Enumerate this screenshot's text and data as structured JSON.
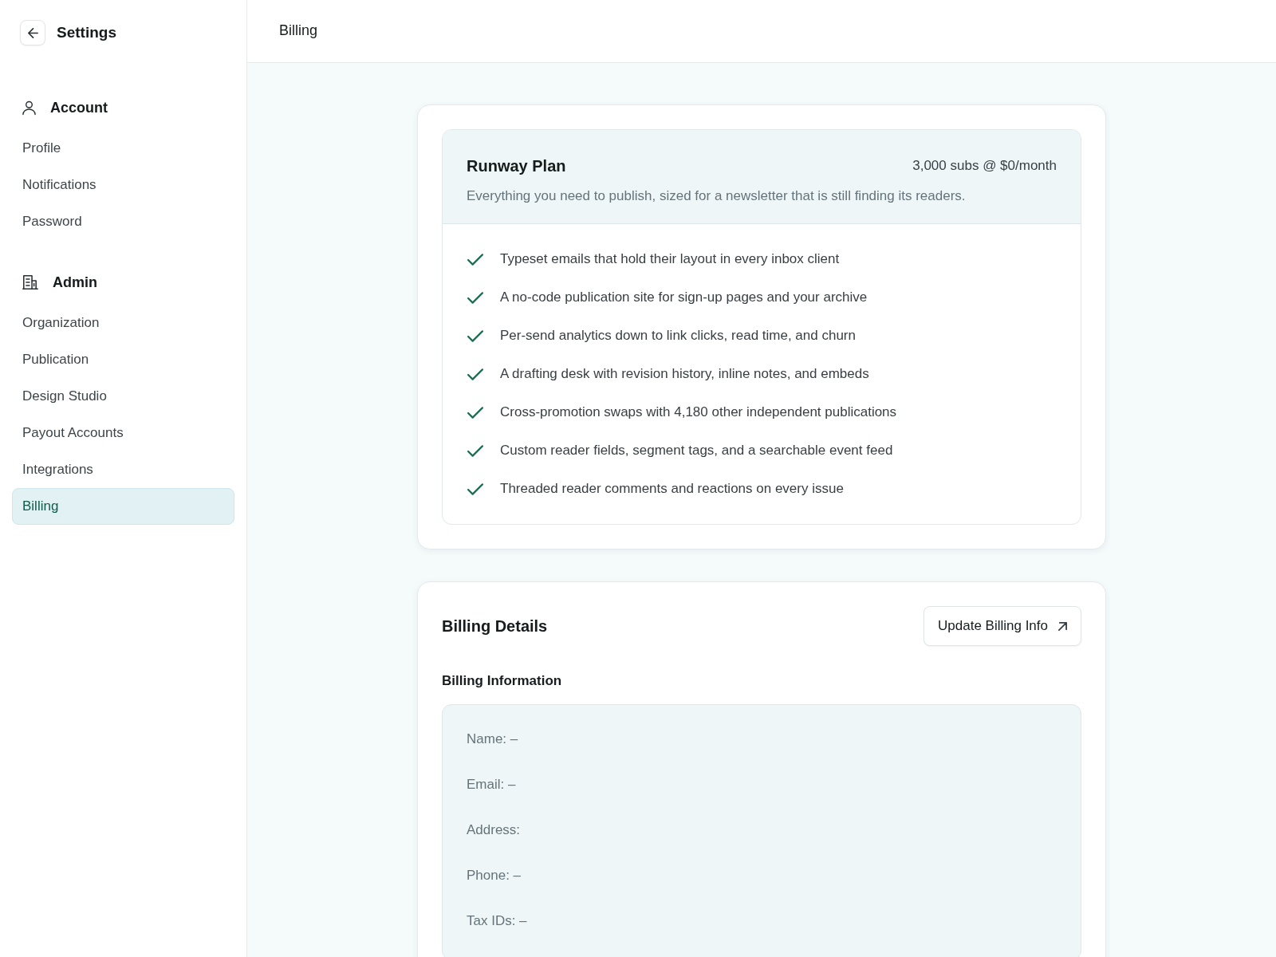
{
  "sidebar": {
    "title": "Settings",
    "sections": [
      {
        "heading": "Account",
        "items": [
          {
            "label": "Profile",
            "selected": false
          },
          {
            "label": "Notifications",
            "selected": false
          },
          {
            "label": "Password",
            "selected": false
          }
        ]
      },
      {
        "heading": "Admin",
        "items": [
          {
            "label": "Organization",
            "selected": false
          },
          {
            "label": "Publication",
            "selected": false
          },
          {
            "label": "Design Studio",
            "selected": false
          },
          {
            "label": "Payout Accounts",
            "selected": false
          },
          {
            "label": "Integrations",
            "selected": false
          },
          {
            "label": "Billing",
            "selected": true
          }
        ]
      }
    ]
  },
  "header": {
    "title": "Billing"
  },
  "plan": {
    "name": "Runway Plan",
    "price": "3,000 subs @ $0/month",
    "description": "Everything you need to publish, sized for a newsletter that is still finding its readers.",
    "features": [
      {
        "text": "Typeset emails that hold their layout in every inbox client",
        "included": true
      },
      {
        "text": "A no-code publication site for sign-up pages and your archive",
        "included": true
      },
      {
        "text": "Per-send analytics down to link clicks, read time, and churn",
        "included": true
      },
      {
        "text": "A drafting desk with revision history, inline notes, and embeds",
        "included": true
      },
      {
        "text": "Cross-promotion swaps with 4,180 other independent publications",
        "included": true
      },
      {
        "text": "Custom reader fields, segment tags, and a searchable event feed",
        "included": true
      },
      {
        "text": "Threaded reader comments and reactions on every issue",
        "included": true
      }
    ]
  },
  "billing_details": {
    "title": "Billing Details",
    "button": "Update Billing Info",
    "section_title": "Billing Information",
    "fields": [
      "Name: –",
      "Email: –",
      "Address:",
      "Phone: –",
      "Tax IDs: –"
    ]
  }
}
